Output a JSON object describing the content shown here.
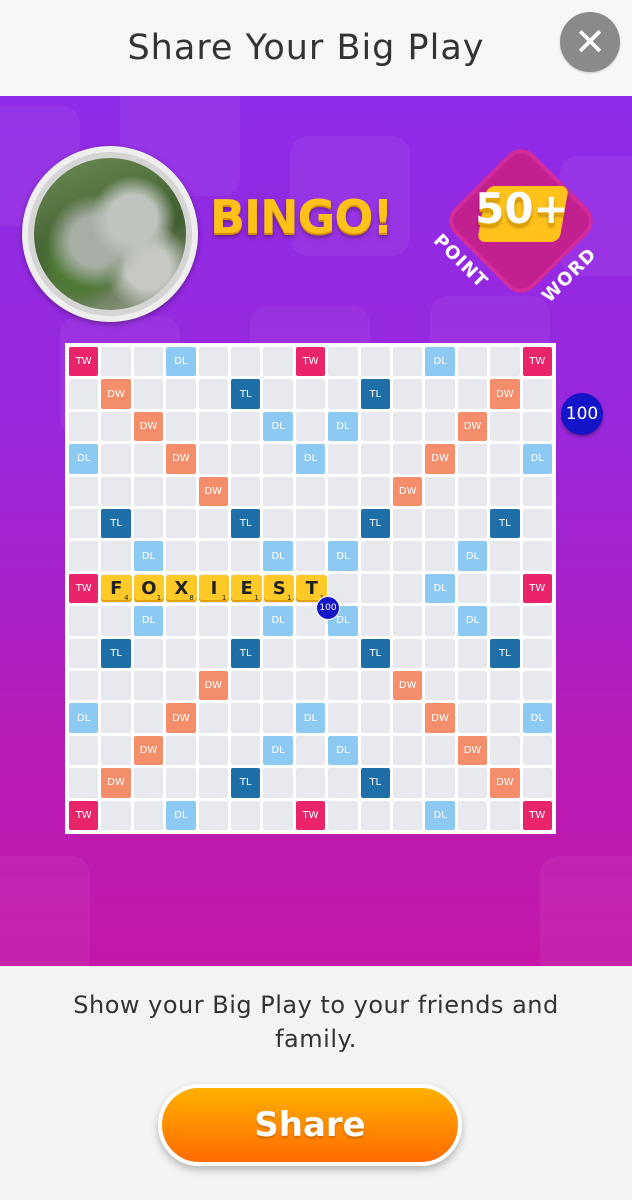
{
  "header": {
    "title": "Share Your Big Play",
    "close_icon": "close-icon",
    "close_glyph": "✕"
  },
  "banner": {
    "bingo_text": "BINGO!",
    "badge": {
      "number": "50+",
      "left_word": "POINT",
      "right_word": "WORD"
    },
    "play_score": "100",
    "colors": {
      "banner_top": "#8f2be8",
      "banner_bottom": "#c517a8",
      "bingo_yellow": "#ffc21a"
    }
  },
  "board": {
    "size": 15,
    "premium_colors": {
      "TW": "#e9246b",
      "DW": "#f48e6a",
      "TL": "#1e6fa8",
      "DL": "#8dcaf3"
    },
    "rows": [
      "TW,,,DL,,,,TW,,,,DL,,,TW",
      ",DW,,,,TL,,,,TL,,,,DW,",
      ",,DW,,,,DL,,DL,,,,DW,,",
      "DL,,,DW,,,,DL,,,,DW,,,DL",
      ",,,,DW,,,,,,DW,,,,",
      ",TL,,,,TL,,,,TL,,,,TL,",
      ",,DL,,,,DL,,DL,,,,DL,,",
      "TW,,,,,,,,,,,DL,,,TW",
      ",,DL,,,,DL,,DL,,,,DL,,",
      ",TL,,,,TL,,,,TL,,,,TL,",
      ",,,,DW,,,,,,DW,,,,",
      "DL,,,DW,,,,DL,,,,DW,,,DL",
      ",,DW,,,,DL,,DL,,,,DW,,",
      ",DW,,,,TL,,,,TL,,,,DW,",
      "TW,,,DL,,,,TW,,,,DL,,,TW"
    ],
    "word": {
      "text": "FOXIEST",
      "tiles": [
        {
          "letter": "F",
          "points": "4"
        },
        {
          "letter": "O",
          "points": "1"
        },
        {
          "letter": "X",
          "points": "8"
        },
        {
          "letter": "I",
          "points": "1"
        },
        {
          "letter": "E",
          "points": "1"
        },
        {
          "letter": "S",
          "points": "1"
        },
        {
          "letter": "T",
          "points": "1"
        }
      ],
      "score": "100"
    }
  },
  "footer": {
    "message": "Show your Big Play to your friends and family.",
    "share_label": "Share"
  }
}
